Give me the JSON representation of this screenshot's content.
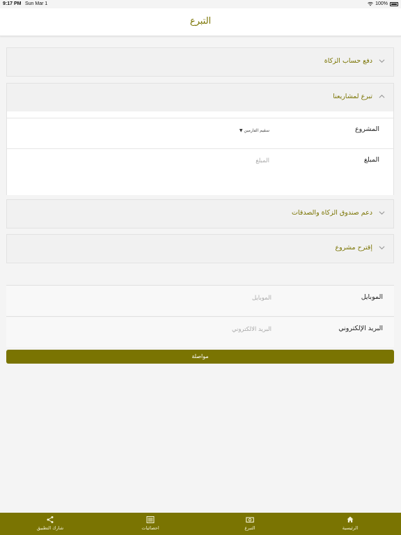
{
  "status": {
    "time": "9:17 PM",
    "date": "Sun Mar 1",
    "battery": "100%"
  },
  "header": {
    "title": "التبرع"
  },
  "sections": [
    {
      "label": "دفع حساب الزكاة",
      "expanded": false
    },
    {
      "label": "تبرع لمشاريعنا",
      "expanded": true,
      "fields": [
        {
          "label": "المشروع",
          "value": "سقيم الفارمين"
        },
        {
          "label": "المبلغ",
          "placeholder": "المبلغ"
        }
      ]
    },
    {
      "label": "دعم صندوق الزكاة والصدقات",
      "expanded": false
    },
    {
      "label": "إقترح مشروع",
      "expanded": false
    }
  ],
  "contact": {
    "mobile": {
      "label": "الموبايل",
      "placeholder": "الموبايل"
    },
    "email": {
      "label": "البريد الإلكتروني",
      "placeholder": "البريد الالكتروني"
    }
  },
  "submit_label": "مواصلة",
  "tabs": [
    {
      "label": "الرئيسية",
      "icon": "home-icon"
    },
    {
      "label": "التبرع",
      "icon": "money-icon"
    },
    {
      "label": "احصائيات",
      "icon": "stats-icon"
    },
    {
      "label": "شارك التطبيق",
      "icon": "share-icon"
    }
  ],
  "colors": {
    "accent": "#7a7402",
    "background": "#f4f4f4"
  }
}
